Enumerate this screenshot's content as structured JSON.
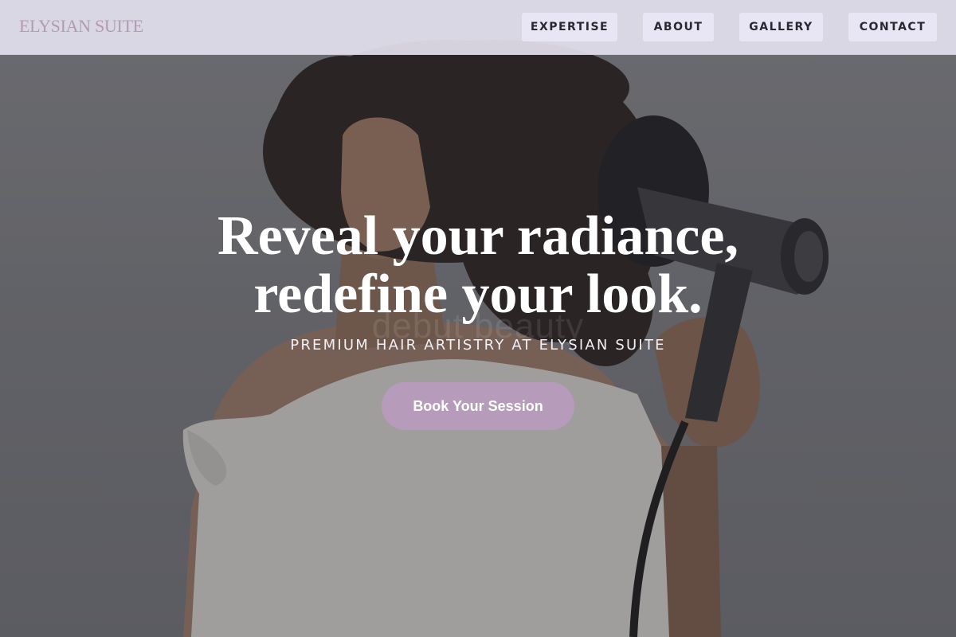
{
  "navbar": {
    "brand": "ELYSIAN SUITE",
    "links": [
      "EXPERTISE",
      "ABOUT",
      "GALLERY",
      "CONTACT"
    ]
  },
  "hero": {
    "headline_line1": "Reveal your radiance,",
    "headline_line2": "redefine your look.",
    "background_wordmark": "debut beauty",
    "subtitle": "PREMIUM HAIR ARTISTRY AT ELYSIAN SUITE",
    "cta_label": "Book Your Session",
    "image_alt": "woman-with-curly-hair-using-hair-dryer"
  },
  "colors": {
    "accent": "#b79bba",
    "brand_text": "#b39ab4",
    "nav_bg": "#e2e0ec",
    "nav_button_bg": "#e8e5f5"
  }
}
